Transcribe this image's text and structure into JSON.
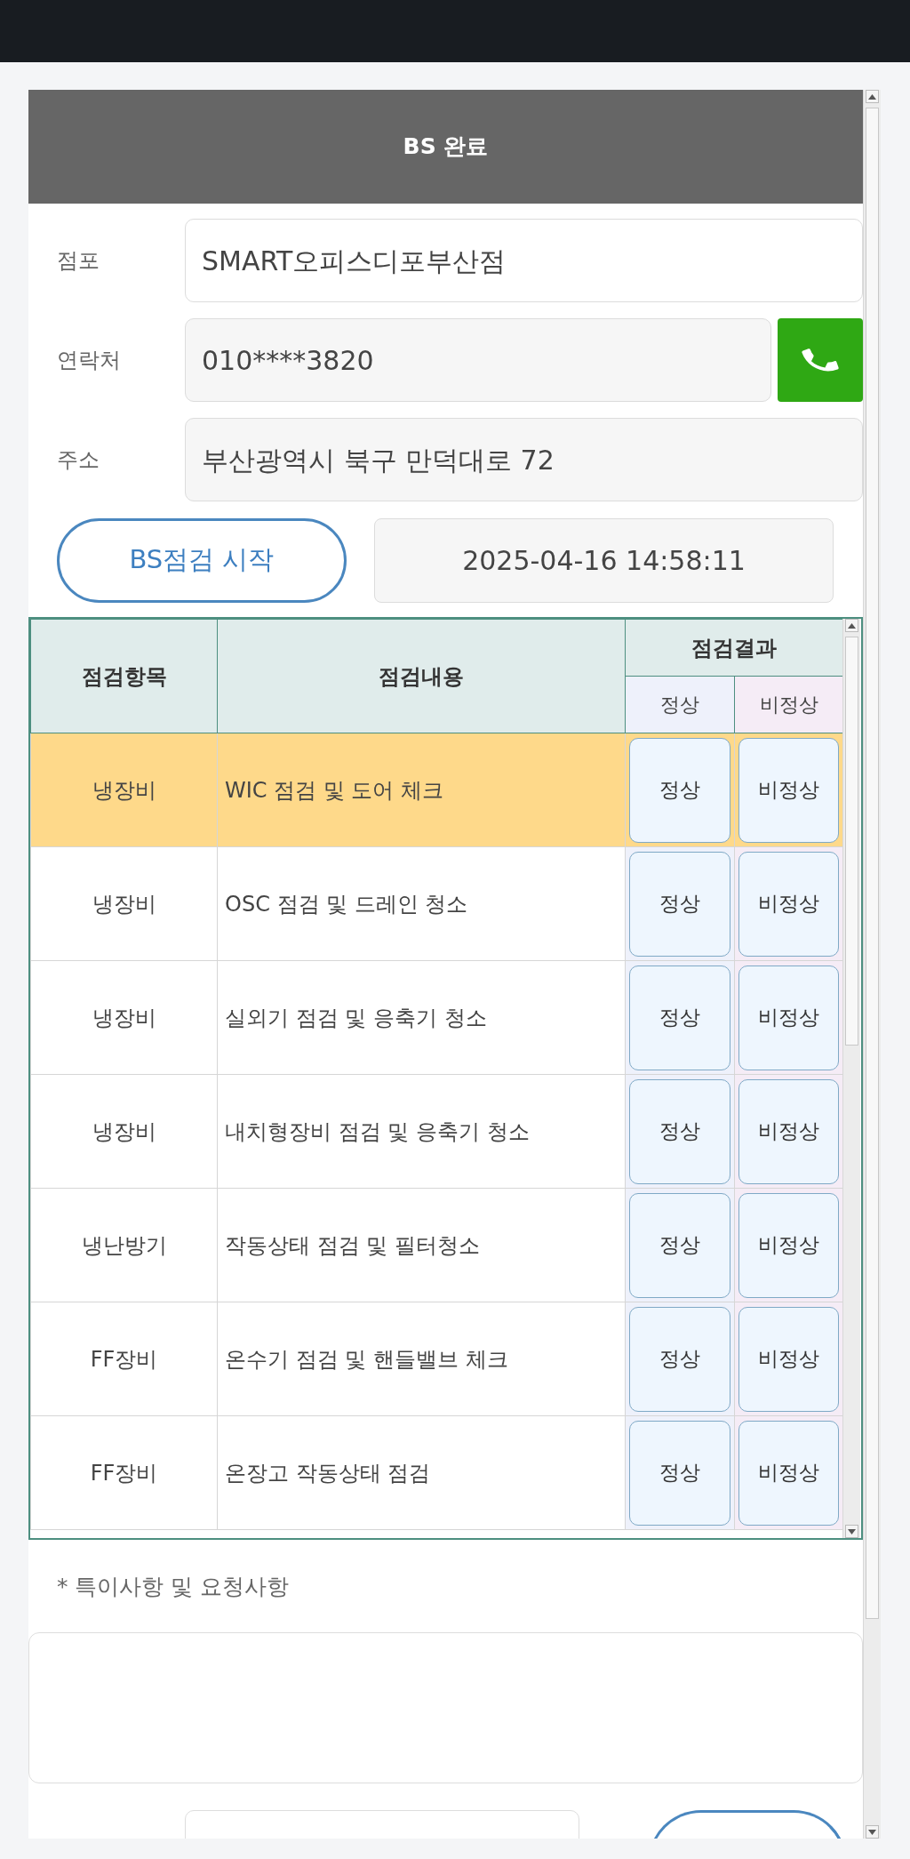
{
  "dialog": {
    "title": "BS 완료"
  },
  "fields": [
    {
      "label": "점포",
      "value": "SMART오피스디포부산점",
      "kind": "plain"
    },
    {
      "label": "연락처",
      "value": "010****3820",
      "kind": "phone"
    },
    {
      "label": "주소",
      "value": "부산광역시 북구 만덕대로 72",
      "kind": "readonly"
    }
  ],
  "start": {
    "button": "BS점검 시작",
    "timestamp": "2025-04-16 14:58:11"
  },
  "table": {
    "columns": {
      "item": "점검항목",
      "content": "점검내용",
      "result": "점검결과",
      "normal": "정상",
      "abnormal": "비정상"
    },
    "rows": [
      {
        "item": "냉장비",
        "content": "WIC 점검 및 도어 체크",
        "normal": "정상",
        "abnormal": "비정상",
        "selected": true
      },
      {
        "item": "냉장비",
        "content": "OSC 점검 및 드레인 청소",
        "normal": "정상",
        "abnormal": "비정상",
        "selected": false
      },
      {
        "item": "냉장비",
        "content": "실외기 점검 및 응축기 청소",
        "normal": "정상",
        "abnormal": "비정상",
        "selected": false
      },
      {
        "item": "냉장비",
        "content": "내치형장비 점검 및 응축기 청소",
        "normal": "정상",
        "abnormal": "비정상",
        "selected": false
      },
      {
        "item": "냉난방기",
        "content": "작동상태 점검 및 필터청소",
        "normal": "정상",
        "abnormal": "비정상",
        "selected": false
      },
      {
        "item": "FF장비",
        "content": "온수기 점검 및 핸들밸브 체크",
        "normal": "정상",
        "abnormal": "비정상",
        "selected": false
      },
      {
        "item": "FF장비",
        "content": "온장고 작동상태 점검",
        "normal": "정상",
        "abnormal": "비정상",
        "selected": false
      }
    ]
  },
  "notes": {
    "label": "* 특이사항 및 요청사항"
  }
}
